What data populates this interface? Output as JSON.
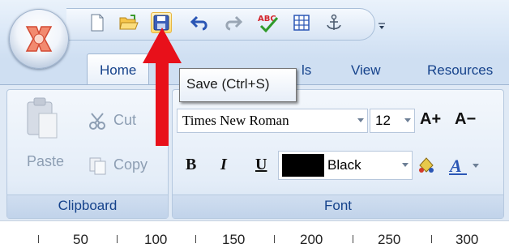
{
  "tabs": [
    {
      "label": "Home"
    },
    {
      "label": "ls"
    },
    {
      "label": "View"
    },
    {
      "label": "Resources"
    }
  ],
  "tooltip": {
    "text": "Save (Ctrl+S)"
  },
  "clipboard": {
    "paste_label": "Paste",
    "cut_label": "Cut",
    "copy_label": "Copy",
    "group_title": "Clipboard"
  },
  "font": {
    "family": "Times New Roman",
    "size": "12",
    "bold_label": "B",
    "italic_label": "I",
    "underline_label": "U",
    "color_name": "Black",
    "color_value": "#000000",
    "grow_label": "A+",
    "shrink_label": "A−",
    "group_title": "Font"
  },
  "ruler": {
    "labels": [
      "50",
      "100",
      "150",
      "200",
      "250",
      "300"
    ]
  },
  "quick_access_icons": [
    "new-document-icon",
    "open-folder-icon",
    "save-icon",
    "undo-icon",
    "redo-icon",
    "spell-check-icon",
    "table-icon",
    "anchor-icon",
    "customize-toolbar-icon"
  ],
  "colors": {
    "accent_red": "#e8101a",
    "tab_text": "#15428b"
  }
}
